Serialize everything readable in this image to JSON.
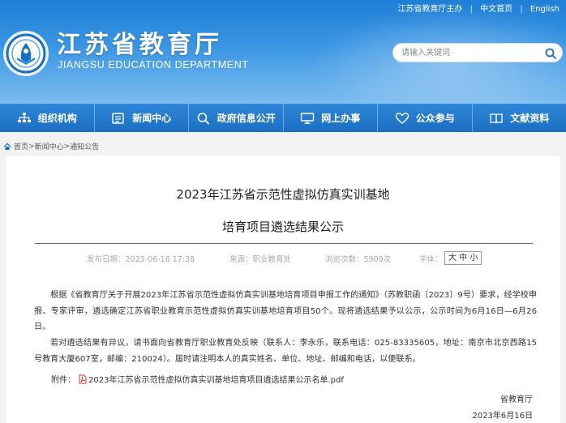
{
  "header": {
    "top_links": [
      "江苏省教育厅主办",
      "中文首页",
      "English"
    ],
    "site_title": "江苏省教育厅",
    "site_subtitle": "JIANGSU EDUCATION DEPARTMENT",
    "search_placeholder": "请输入关键词"
  },
  "nav": [
    {
      "label": "组织机构",
      "icon": "org-chart-icon"
    },
    {
      "label": "新闻中心",
      "icon": "newspaper-icon"
    },
    {
      "label": "政府信息公开",
      "icon": "magnifier-icon"
    },
    {
      "label": "网上办事",
      "icon": "monitor-icon"
    },
    {
      "label": "公众参与",
      "icon": "heart-icon"
    },
    {
      "label": "文献资料",
      "icon": "book-icon"
    }
  ],
  "breadcrumb": [
    "首页",
    "新闻中心",
    "通知公告"
  ],
  "article": {
    "title_line1": "2023年江苏省示范性虚拟仿真实训基地",
    "title_line2": "培育项目遴选结果公示",
    "publish_time": "发布日期：2023-06-16 17:38",
    "source": "来源：职业教育处",
    "views": "浏览次数：5909次",
    "font_label": "字体：",
    "font_sizes": "大 中 小",
    "paragraph1": "根据《省教育厅关于开展2023年江苏省示范性虚拟仿真实训基地培育项目申报工作的通知》（苏教职函〔2023〕9号）要求，经学校申报、专家评审，遴选确定江苏省职业教育示范性虚拟仿真实训基地培育项目50个。现将遴选结果予以公示，公示时间为6月16日—6月26日。",
    "paragraph2": "若对遴选结果有异议，请书面向省教育厅职业教育处反映（联系人：李永乐，联系电话：025-83335605，地址：南京市北京西路15号教育大厦607室，邮编：210024）。届时请注明本人的真实姓名、单位、地址、邮编和电话，以便联系。",
    "attachment_label": "附件：",
    "attachment_name": "2023年江苏省示范性虚拟仿真实训基地培育项目遴选结果公示名单.pdf",
    "signature": "省教育厅",
    "date": "2023年6月16日"
  },
  "colors": {
    "header_blue": "#1f7fd6",
    "nav_blue": "#1b6fc3",
    "pdf_red": "#d9372b"
  }
}
